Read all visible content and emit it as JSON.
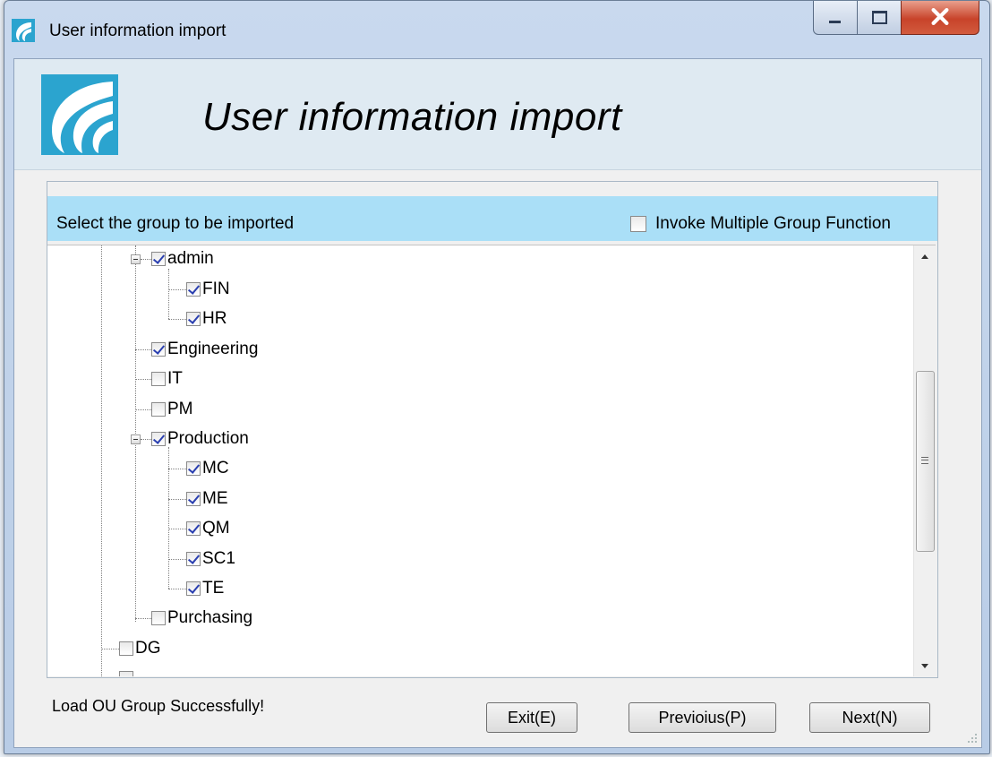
{
  "window": {
    "title": "User information import",
    "controls": {
      "minimize": "minimize",
      "maximize": "maximize",
      "close": "X"
    }
  },
  "header": {
    "title": "User information import"
  },
  "panel": {
    "label": "Select the group to be imported",
    "multi_group": {
      "label": "Invoke Multiple Group Function",
      "checked": false
    }
  },
  "tree": [
    {
      "label": "admin",
      "checked": true,
      "level": 1,
      "expanded": true
    },
    {
      "label": "FIN",
      "checked": true,
      "level": 2
    },
    {
      "label": "HR",
      "checked": true,
      "level": 2
    },
    {
      "label": "Engineering",
      "checked": true,
      "level": 1
    },
    {
      "label": "IT",
      "checked": false,
      "level": 1
    },
    {
      "label": "PM",
      "checked": false,
      "level": 1
    },
    {
      "label": "Production",
      "checked": true,
      "level": 1,
      "expanded": true
    },
    {
      "label": "MC",
      "checked": true,
      "level": 2
    },
    {
      "label": "ME",
      "checked": true,
      "level": 2
    },
    {
      "label": "QM",
      "checked": true,
      "level": 2
    },
    {
      "label": "SC1",
      "checked": true,
      "level": 2
    },
    {
      "label": "TE",
      "checked": true,
      "level": 2
    },
    {
      "label": "Purchasing",
      "checked": false,
      "level": 1
    },
    {
      "label": "DG",
      "checked": false,
      "level": 0
    }
  ],
  "status": "Load OU Group Successfully!",
  "buttons": {
    "exit": "Exit(E)",
    "previous": "Previoius(P)",
    "next": "Next(N)"
  },
  "colors": {
    "header_bg": "#dfeaf2",
    "panel_head_bg": "#aadff7",
    "check_color": "#2a3fb0"
  }
}
